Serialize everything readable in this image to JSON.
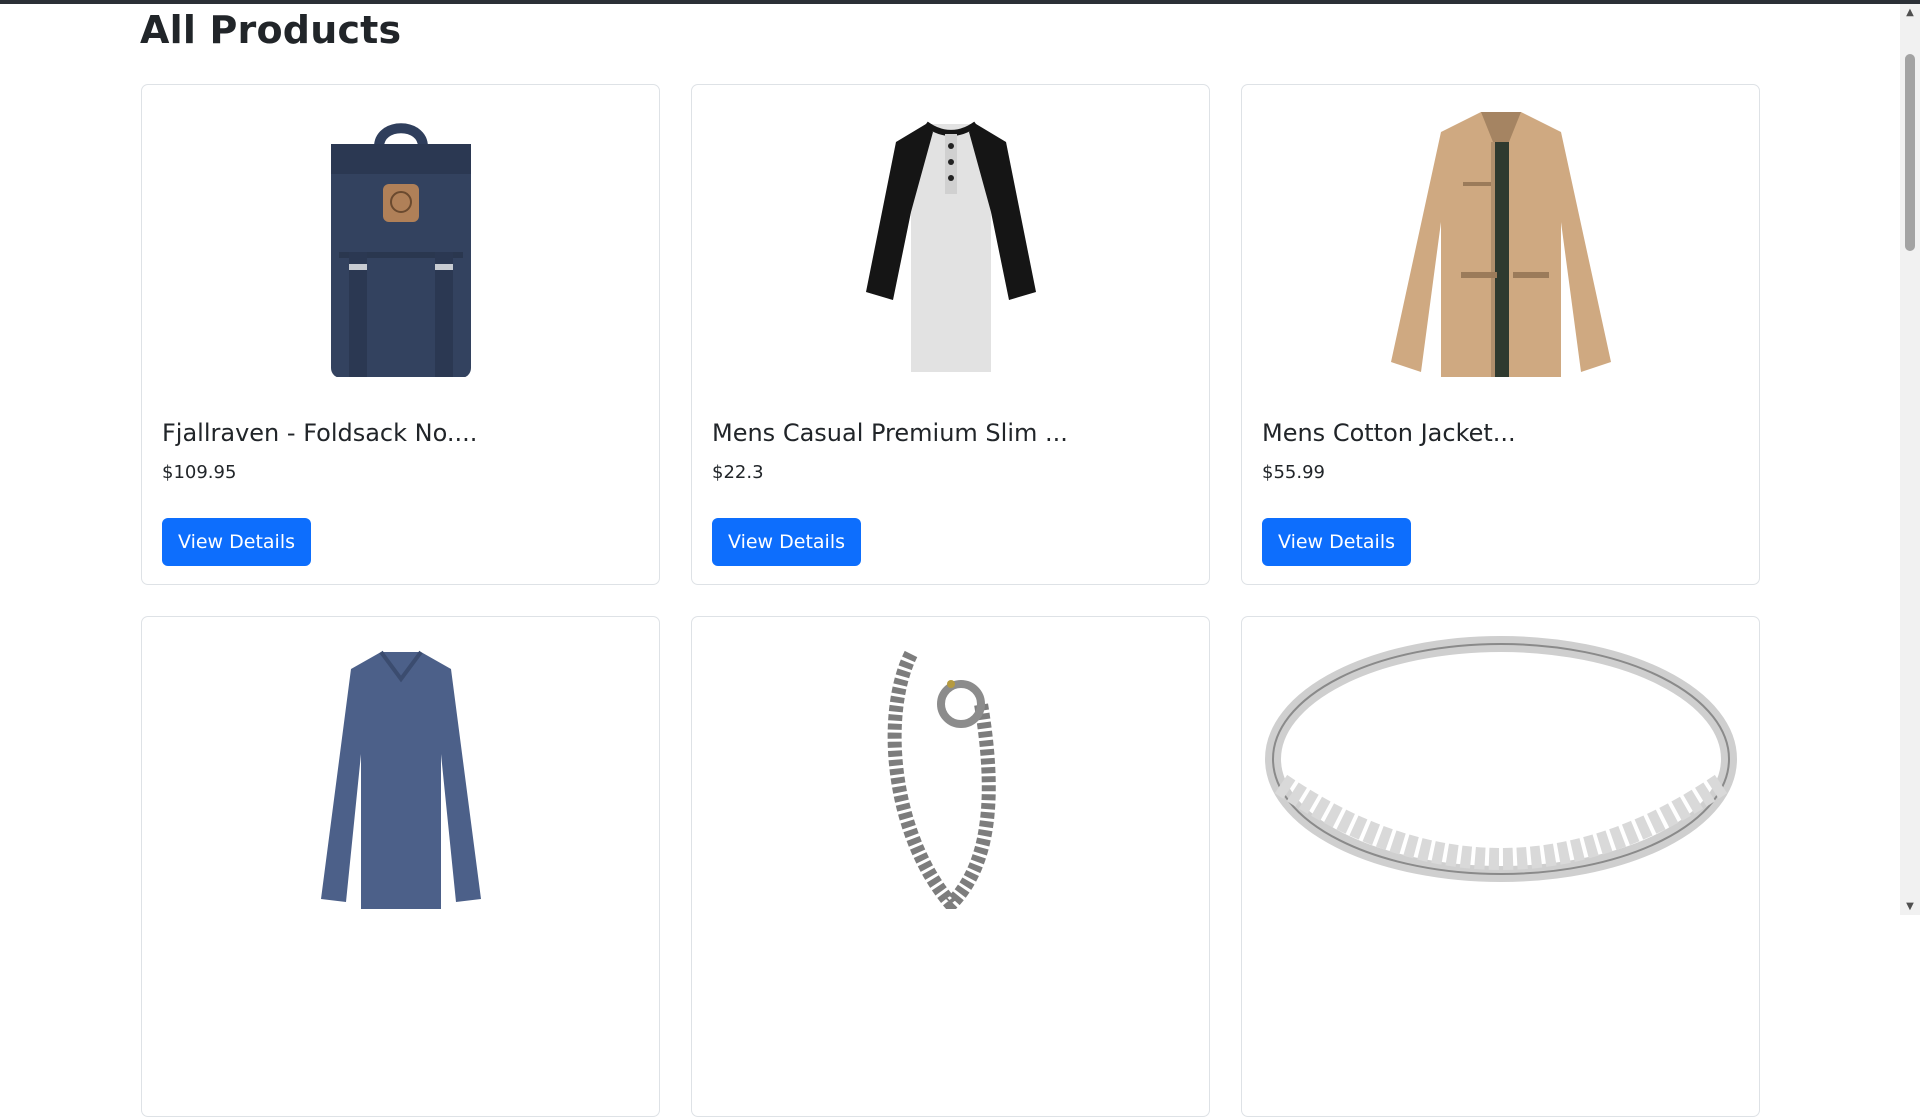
{
  "page": {
    "heading": "All Products"
  },
  "products": [
    {
      "title": "Fjallraven - Foldsack No....",
      "price": "$109.95",
      "button": "View Details"
    },
    {
      "title": "Mens Casual Premium Slim ...",
      "price": "$22.3",
      "button": "View Details"
    },
    {
      "title": "Mens Cotton Jacket...",
      "price": "$55.99",
      "button": "View Details"
    },
    {
      "title": "",
      "price": "",
      "button": ""
    },
    {
      "title": "",
      "price": "",
      "button": ""
    },
    {
      "title": "",
      "price": "",
      "button": ""
    }
  ],
  "scrollbar": {
    "up_icon": "▲",
    "down_icon": "▼"
  },
  "colors": {
    "accent": "#0d6efd",
    "text": "#212529",
    "border": "#dee2e6"
  }
}
